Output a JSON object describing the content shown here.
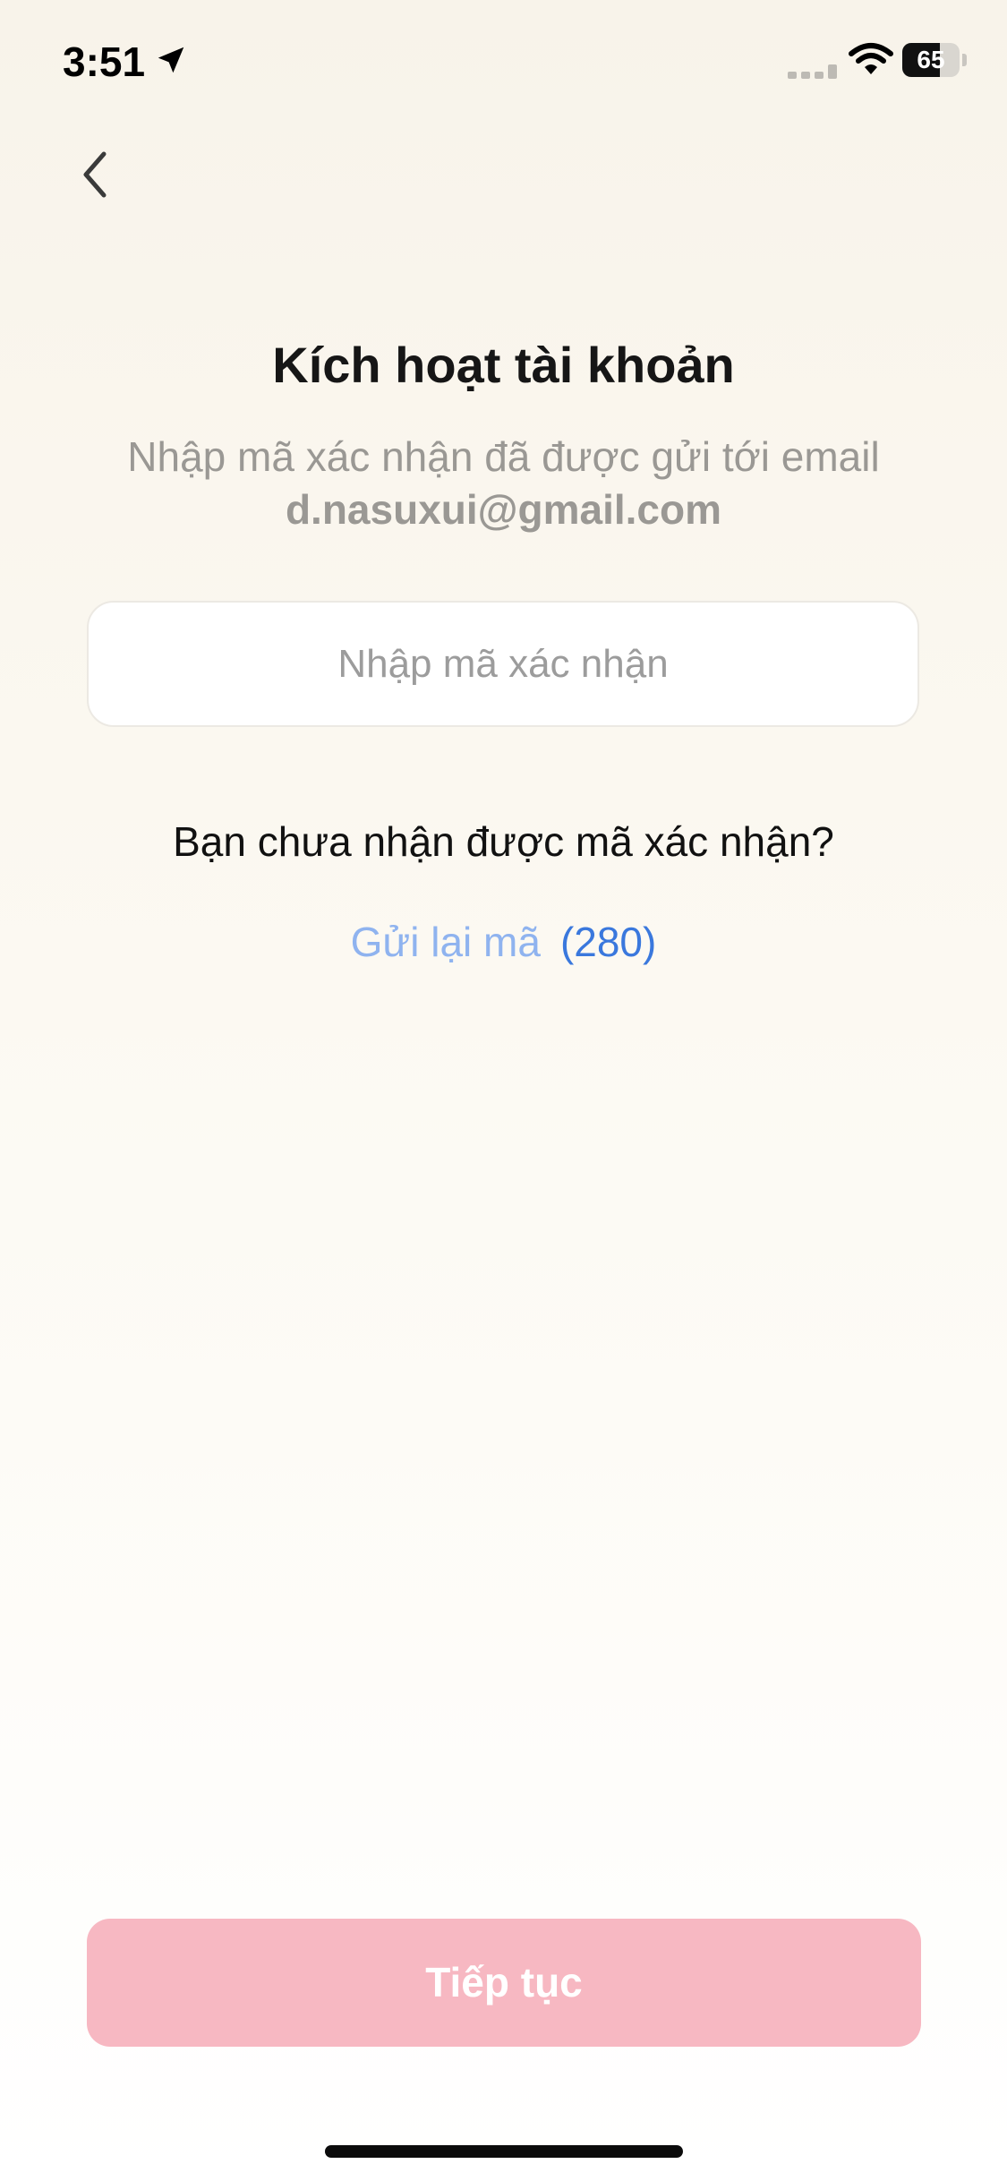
{
  "status_bar": {
    "time": "3:51",
    "battery_level": "65",
    "battery_fraction": 0.65
  },
  "icons": {
    "back": "chevron-left-icon",
    "location": "location-arrow-icon",
    "signal": "cellular-signal-icon",
    "wifi": "wifi-icon",
    "battery": "battery-icon"
  },
  "header": {
    "title": "Kích hoạt tài khoản",
    "subtitle": "Nhập mã xác nhận đã được gửi tới email",
    "email": "d.nasuxui@gmail.com"
  },
  "form": {
    "code_placeholder": "Nhập mã xác nhận",
    "code_value": ""
  },
  "resend": {
    "question": "Bạn chưa nhận được mã xác nhận?",
    "link_label": "Gửi lại mã",
    "countdown": "(280)"
  },
  "footer": {
    "continue_label": "Tiếp tục"
  },
  "colors": {
    "accent_pink": "#f7b8c2",
    "link_blue": "#8fb3ef",
    "countdown_blue": "#3a78dd",
    "muted_text": "#9a9894"
  }
}
